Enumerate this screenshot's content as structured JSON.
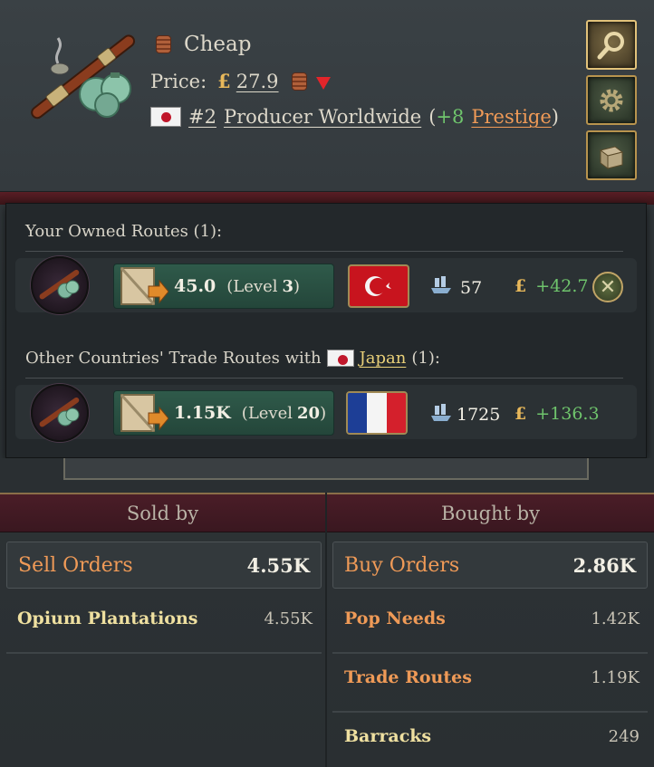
{
  "header": {
    "tier": "Cheap",
    "price_label": "Price:",
    "currency": "£",
    "price": "27.9",
    "rank": "#2",
    "producer_text": "Producer Worldwide",
    "prestige_open": "(",
    "prestige_amount": "+8",
    "prestige_label": "Prestige",
    "prestige_close": ")",
    "side_buttons": [
      "magnifier-icon",
      "gear-icon",
      "crate-icon"
    ]
  },
  "routes": {
    "owned_title": "Your Owned Routes (1):",
    "owned": {
      "volume": "45.0",
      "level_open": "(Level",
      "level": "3",
      "level_close": ")",
      "partner_flag": "ottoman",
      "convoys": "57",
      "currency": "£",
      "profit": "+42.7"
    },
    "other_title_prefix": "Other Countries' Trade Routes with",
    "other_country": "Japan",
    "other_count": "(1):",
    "other": {
      "volume": "1.15K",
      "level_open": "(Level",
      "level": "20",
      "level_close": ")",
      "partner_flag": "france",
      "convoys": "1725",
      "currency": "£",
      "profit": "+136.3"
    }
  },
  "sold_by": {
    "title": "Sold by",
    "orders_label": "Sell Orders",
    "orders_value": "4.55K",
    "entries": [
      {
        "name": "Opium Plantations",
        "value": "4.55K"
      }
    ]
  },
  "bought_by": {
    "title": "Bought by",
    "orders_label": "Buy Orders",
    "orders_value": "2.86K",
    "entries": [
      {
        "name": "Pop Needs",
        "value": "1.42K"
      },
      {
        "name": "Trade Routes",
        "value": "1.19K"
      },
      {
        "name": "Barracks",
        "value": "249"
      }
    ]
  },
  "colors": {
    "positive": "#6fc46c",
    "highlight": "#ef9a57",
    "currency": "#e8b85a",
    "panel_header": "#4a1d27"
  }
}
